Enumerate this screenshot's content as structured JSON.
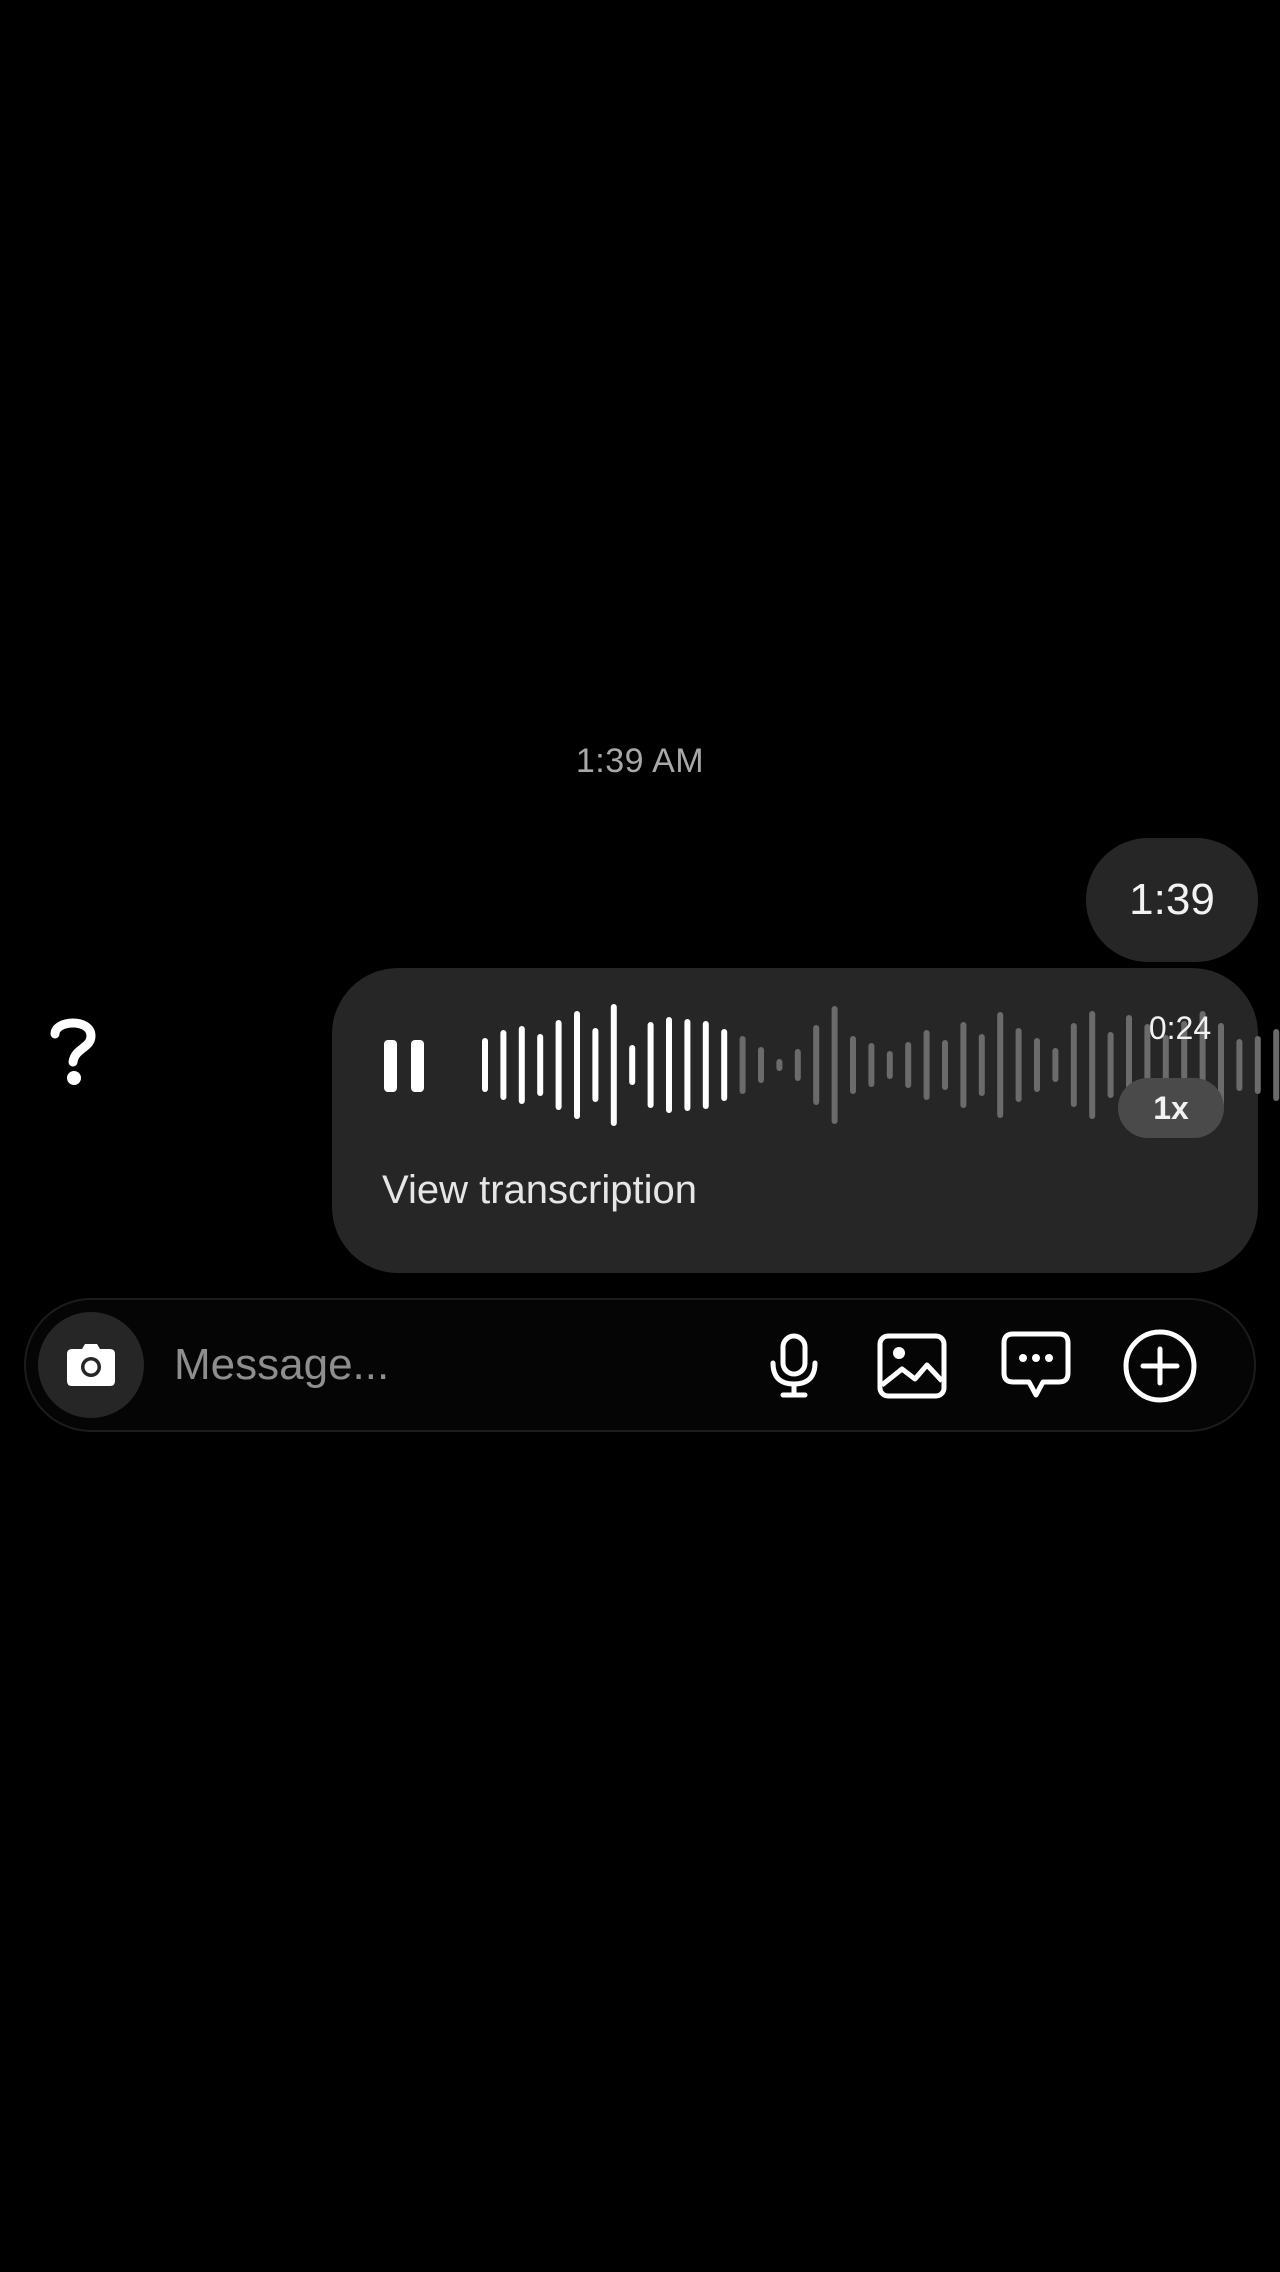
{
  "conversation": {
    "timestamp": "1:39 AM",
    "messages": [
      {
        "type": "text",
        "sender": "self",
        "text": "1:39"
      },
      {
        "type": "voice",
        "sender": "self",
        "state": "playing",
        "duration": "0:24",
        "speed": "1x",
        "progress": 0.29,
        "transcription_link": "View transcription"
      }
    ],
    "avatar_icon": "question-mark-icon"
  },
  "composer": {
    "placeholder": "Message...",
    "value": "",
    "icons": {
      "camera": "camera-icon",
      "mic": "microphone-icon",
      "gallery": "gallery-icon",
      "sticker": "sticker-chat-icon",
      "plus": "plus-circle-icon"
    }
  },
  "colors": {
    "background": "#000000",
    "bubble": "#262626",
    "waveform_played": "#ffffff",
    "waveform_unplayed": "#6b6b6b",
    "speed_pill": "#4a4a4a",
    "placeholder": "#8e8e8e",
    "timestamp": "#a8a8a8"
  }
}
